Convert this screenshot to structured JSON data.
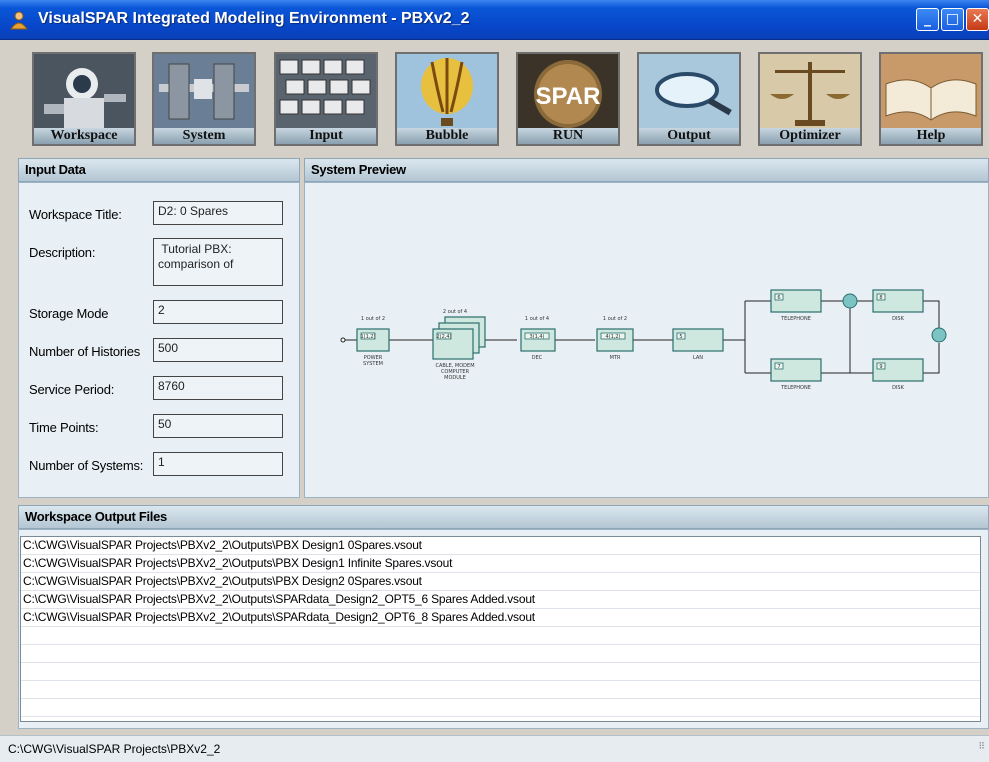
{
  "window": {
    "title": "VisualSPAR Integrated Modeling Environment  - PBXv2_2",
    "minimize": "_",
    "maximize": "□",
    "close": "✕"
  },
  "toolbar": {
    "buttons": [
      {
        "label": "Workspace",
        "icon": "astronaut-image"
      },
      {
        "label": "System",
        "icon": "space-station-image"
      },
      {
        "label": "Input",
        "icon": "keyboard-image"
      },
      {
        "label": "Bubble",
        "icon": "balloon-image"
      },
      {
        "label": "RUN",
        "icon": "spar-globe-image",
        "badge": "SPAR"
      },
      {
        "label": "Output",
        "icon": "magnifier-image"
      },
      {
        "label": "Optimizer",
        "icon": "scales-image"
      },
      {
        "label": "Help",
        "icon": "book-image"
      }
    ]
  },
  "input_data": {
    "header": "Input Data",
    "fields": [
      {
        "label": "Workspace Title:",
        "value": "D2: 0 Spares"
      },
      {
        "label": "Description:",
        "value": " Tutorial PBX:\ncomparison of"
      },
      {
        "label": "Storage Mode",
        "value": "2"
      },
      {
        "label": "Number of Histories",
        "value": "500"
      },
      {
        "label": "Service Period:",
        "value": "8760"
      },
      {
        "label": "Time Points:",
        "value": "50"
      },
      {
        "label": "Number of Systems:",
        "value": "1"
      }
    ]
  },
  "system_preview": {
    "header": "System Preview",
    "blocks": [
      {
        "name": "POWER\nSYSTEM",
        "top_label": "1 out of 2",
        "id": "1(1,2)"
      },
      {
        "name": "CABLE, MODEM\nCOMPUTER\nMODULE",
        "top_label": "2 out of 4",
        "id": "2(2,4)"
      },
      {
        "name": "DEC",
        "top_label": "1 out of 4",
        "id": "3(1,4)"
      },
      {
        "name": "MTR",
        "top_label": "1 out of 2",
        "id": "4(1,2)"
      },
      {
        "name": "LAN",
        "top_label": "",
        "id": "5"
      },
      {
        "name": "TELEPHONE",
        "top_label": "",
        "id": "6"
      },
      {
        "name": "TELEPHONE",
        "top_label": "",
        "id": "7"
      },
      {
        "name": "DISK",
        "top_label": "",
        "id": "8"
      },
      {
        "name": "DISK",
        "top_label": "",
        "id": "9"
      }
    ]
  },
  "output_files": {
    "header": "Workspace Output Files",
    "files": [
      "C:\\CWG\\VisualSPAR Projects\\PBXv2_2\\Outputs\\PBX Design1 0Spares.vsout",
      "C:\\CWG\\VisualSPAR Projects\\PBXv2_2\\Outputs\\PBX Design1 Infinite Spares.vsout",
      "C:\\CWG\\VisualSPAR Projects\\PBXv2_2\\Outputs\\PBX Design2 0Spares.vsout",
      "C:\\CWG\\VisualSPAR Projects\\PBXv2_2\\Outputs\\SPARdata_Design2_OPT5_6 Spares Added.vsout",
      "C:\\CWG\\VisualSPAR Projects\\PBXv2_2\\Outputs\\SPARdata_Design2_OPT6_8 Spares Added.vsout",
      "",
      "",
      "",
      "",
      "",
      ""
    ]
  },
  "status_bar": {
    "path": "C:\\CWG\\VisualSPAR Projects\\PBXv2_2"
  },
  "colors": {
    "titlebar": "#0a56d8",
    "panel_bg": "#e8f0f5",
    "block_fill": "#cfe8df",
    "block_stroke": "#2c6d6d"
  }
}
